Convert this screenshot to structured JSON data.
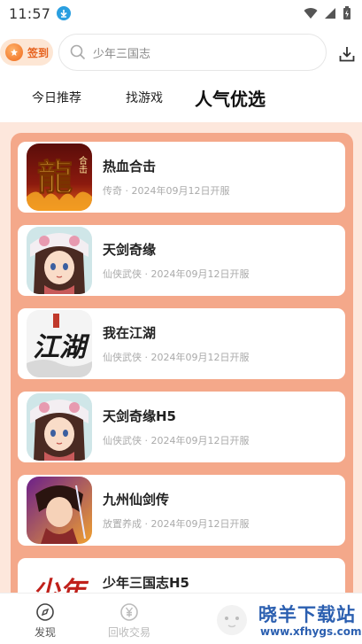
{
  "status_bar": {
    "time": "11:57"
  },
  "header": {
    "signin_label": "签到",
    "search_placeholder": "少年三国志"
  },
  "tabs": [
    {
      "label": "今日推荐"
    },
    {
      "label": "找游戏"
    },
    {
      "label": "人气优选"
    }
  ],
  "games": [
    {
      "title": "热血合击",
      "meta": "传奇 · 2024年09月12日开服",
      "icon": "dragon-logo-icon",
      "icon_text": "龍",
      "icon_badge": "合击"
    },
    {
      "title": "天剑奇缘",
      "meta": "仙侠武侠 · 2024年09月12日开服",
      "icon": "anime-girl-icon"
    },
    {
      "title": "我在江湖",
      "meta": "仙侠武侠 · 2024年09月12日开服",
      "icon": "jianghu-calligraphy-icon",
      "icon_text": "江湖"
    },
    {
      "title": "天剑奇缘H5",
      "meta": "仙侠武侠 · 2024年09月12日开服",
      "icon": "anime-girl-icon"
    },
    {
      "title": "九州仙剑传",
      "meta": "放置养成 · 2024年09月12日开服",
      "icon": "swordsman-icon"
    },
    {
      "title": "少年三国志H5",
      "meta": "",
      "icon": "shaonian-logo-icon",
      "icon_text": "少年"
    }
  ],
  "bottom_nav": [
    {
      "label": "发现",
      "icon": "discover-icon"
    },
    {
      "label": "回收交易",
      "icon": "yuan-coin-icon"
    }
  ],
  "watermark": {
    "text": "晓羊下载站",
    "url": "www.xfhygs.com"
  },
  "colors": {
    "accent": "#f4a88a",
    "panel_bg": "#fde7dc",
    "signin_text": "#e6601b",
    "watermark": "#2b5fb0"
  }
}
